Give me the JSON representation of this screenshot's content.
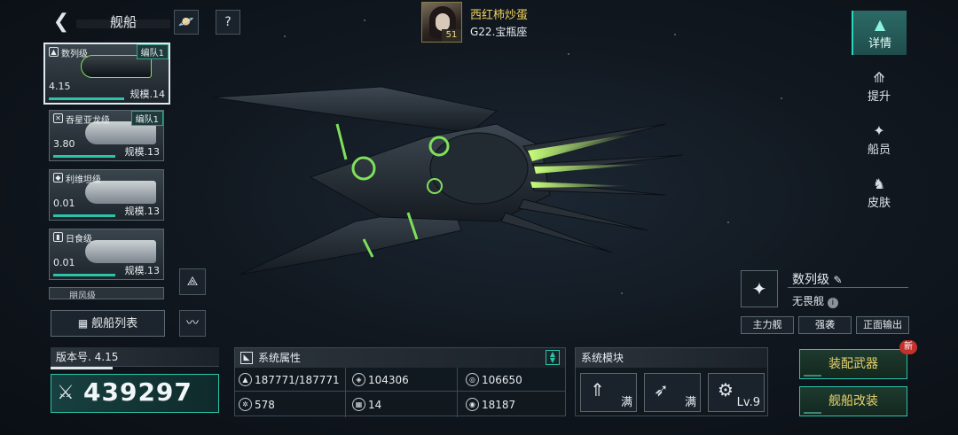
{
  "header": {
    "title": "舰船",
    "back_icon": "back-arrow-icon",
    "planet_icon": "planet-icon",
    "help_icon": "help-icon"
  },
  "player": {
    "name": "西红柿炒蛋",
    "level": "51",
    "server": "G22.宝瓶座"
  },
  "ship_cards": [
    {
      "name": "数列级",
      "value": "4.15",
      "scale": "规模.14",
      "team": "编队1"
    },
    {
      "name": "吞星亚龙级",
      "value": "3.80",
      "scale": "规模.13",
      "team": "编队1"
    },
    {
      "name": "利维坦级",
      "value": "0.01",
      "scale": "规模.13",
      "team": ""
    },
    {
      "name": "日食级",
      "value": "0.01",
      "scale": "规模.13",
      "team": ""
    },
    {
      "name": "朋风级",
      "value": "",
      "scale": "",
      "team": ""
    }
  ],
  "ship_list_button": "舰船列表",
  "tabs": [
    {
      "label": "详情",
      "icon": "details-icon"
    },
    {
      "label": "提升",
      "icon": "upgrade-icon"
    },
    {
      "label": "船员",
      "icon": "crew-icon"
    },
    {
      "label": "皮肤",
      "icon": "skin-icon"
    }
  ],
  "ship_info": {
    "class_name": "数列级",
    "subtype": "无畏舰",
    "tags": [
      "主力舰",
      "强袭",
      "正面输出"
    ]
  },
  "version": {
    "label": "版本号. 4.15",
    "power": "439297"
  },
  "system_attributes": {
    "title": "系统属性",
    "stats": [
      {
        "icon": "hp-icon",
        "value": "187771/187771"
      },
      {
        "icon": "armor-icon",
        "value": "104306"
      },
      {
        "icon": "shield-icon",
        "value": "106650"
      },
      {
        "icon": "speed-icon",
        "value": "578"
      },
      {
        "icon": "grid-icon",
        "value": "14"
      },
      {
        "icon": "radar-icon",
        "value": "18187"
      }
    ]
  },
  "system_modules": {
    "title": "系统模块",
    "slots": [
      {
        "icon": "rocket-icon",
        "label": "满"
      },
      {
        "icon": "missile-icon",
        "label": "满"
      },
      {
        "icon": "drone-icon",
        "label": "Lv.9"
      }
    ]
  },
  "actions": {
    "equip_weapons": "装配武器",
    "modify_ship": "舰船改装",
    "new_badge": "新"
  }
}
